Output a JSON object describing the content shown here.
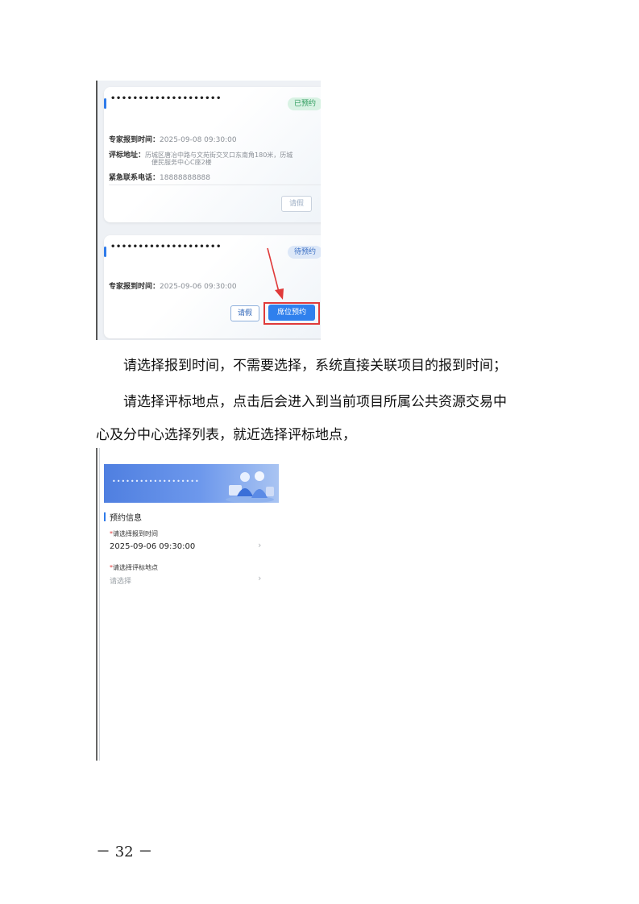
{
  "screenshot1": {
    "card1": {
      "title": "••••••••••••••••••••",
      "status": "已预约",
      "arrival_label": "专家报到时间：",
      "arrival_value": "2025-09-08 09:30:00",
      "address_label": "评标地址：",
      "address_line1": "历城区唐冶中路与文苑街交叉口东南角180米，历城",
      "address_line2": "便民服务中心C座2楼",
      "phone_label": "紧急联系电话：",
      "phone_value": "18888888888",
      "leave_button": "请假"
    },
    "card2": {
      "title": "••••••••••••••••••••",
      "status": "待预约",
      "arrival_label": "专家报到时间：",
      "arrival_value": "2025-09-06 09:30:00",
      "leave_button": "请假",
      "reserve_button": "席位预约"
    }
  },
  "paragraphs": {
    "p1": "请选择报到时间，不需要选择，系统直接关联项目的报到时间；",
    "p2_line1": "请选择评标地点，点击后会进入到当前项目所属公共资源交易中",
    "p2_line2": "心及分中心选择列表，就近选择评标地点，"
  },
  "screenshot2": {
    "banner_title": "•••••••••••••••••••",
    "section_title": "预约信息",
    "field1_star": "*",
    "field1_label": "请选择报到时间",
    "field1_value": "2025-09-06 09:30:00",
    "field2_star": "*",
    "field2_label": "请选择评标地点",
    "field2_placeholder": "请选择",
    "chevron": "›"
  },
  "page_number": "－ 32 －",
  "colors": {
    "accent": "#2f80ed",
    "highlight": "#e03a3a",
    "status_done": "#2a9a5a",
    "status_wait": "#3b6fc4"
  }
}
